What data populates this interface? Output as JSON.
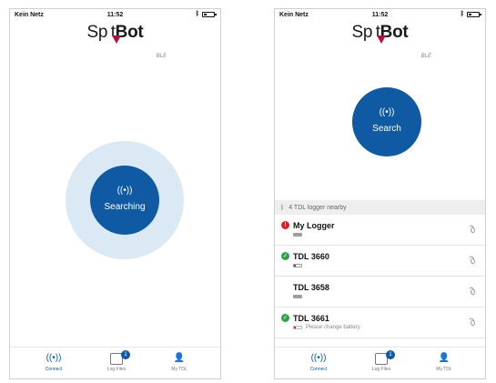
{
  "status": {
    "carrier": "Kein Netz",
    "time": "11:52"
  },
  "logo": {
    "spot": "Sp t",
    "bot": "Bot",
    "sub": "BLE"
  },
  "left_screen": {
    "circle_icon": "((•))",
    "circle_label": "Searching"
  },
  "right_screen": {
    "circle_icon": "((•))",
    "circle_label": "Search",
    "nearby_label": "4 TDL logger nearby",
    "devices": [
      {
        "name": "My Logger",
        "status": "error",
        "note": ""
      },
      {
        "name": "TDL 3660",
        "status": "ok",
        "note": ""
      },
      {
        "name": "TDL 3658",
        "status": "none",
        "note": ""
      },
      {
        "name": "TDL 3661",
        "status": "ok",
        "note": "Please change battery"
      }
    ]
  },
  "tabs": [
    {
      "label": "Connect",
      "active": true
    },
    {
      "label": "Log Files",
      "badge": "1"
    },
    {
      "label": "My TDL"
    }
  ],
  "icons": {
    "bluetooth": "bluetooth-icon",
    "link": "link-icon",
    "connect": "connect-icon",
    "log": "log-files-icon",
    "user": "user-icon"
  },
  "colors": {
    "primary": "#0f5aa3",
    "halo": "#dbe9f5",
    "error": "#d5202a",
    "ok": "#2ba24c",
    "brand_pin": "#b0123a"
  }
}
